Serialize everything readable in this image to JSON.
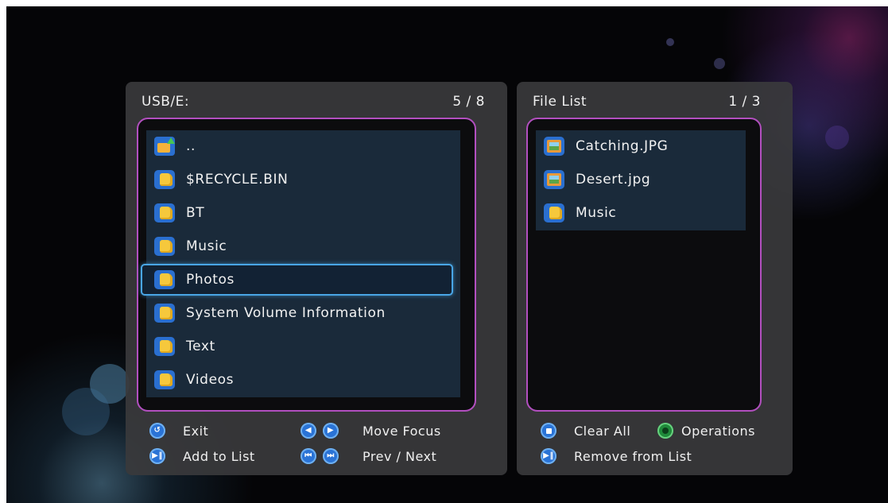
{
  "left_panel": {
    "title": "USB/E:",
    "page": "5 / 8",
    "items": [
      {
        "label": "..",
        "icon": "parent-folder-icon"
      },
      {
        "label": "$RECYCLE.BIN",
        "icon": "folder-icon"
      },
      {
        "label": "BT",
        "icon": "folder-icon"
      },
      {
        "label": "Music",
        "icon": "folder-icon"
      },
      {
        "label": "Photos",
        "icon": "folder-icon",
        "selected": true
      },
      {
        "label": "System Volume Information",
        "icon": "folder-icon"
      },
      {
        "label": "Text",
        "icon": "folder-icon"
      },
      {
        "label": "Videos",
        "icon": "folder-icon"
      }
    ],
    "hints": {
      "exit": "Exit",
      "move_focus": "Move Focus",
      "add_to_list": "Add to List",
      "prev_next": "Prev / Next"
    }
  },
  "right_panel": {
    "title": "File List",
    "page": "1 / 3",
    "items": [
      {
        "label": "Catching.JPG",
        "icon": "image-file-icon"
      },
      {
        "label": "Desert.jpg",
        "icon": "image-file-icon"
      },
      {
        "label": "Music",
        "icon": "folder-icon"
      }
    ],
    "hints": {
      "clear_all": "Clear All",
      "operations": "Operations",
      "remove_from_list": "Remove from List"
    }
  },
  "colors": {
    "panel_border": "#b24fbf",
    "selection_border": "#49a6e6",
    "row_background": "#1a2a3a"
  }
}
